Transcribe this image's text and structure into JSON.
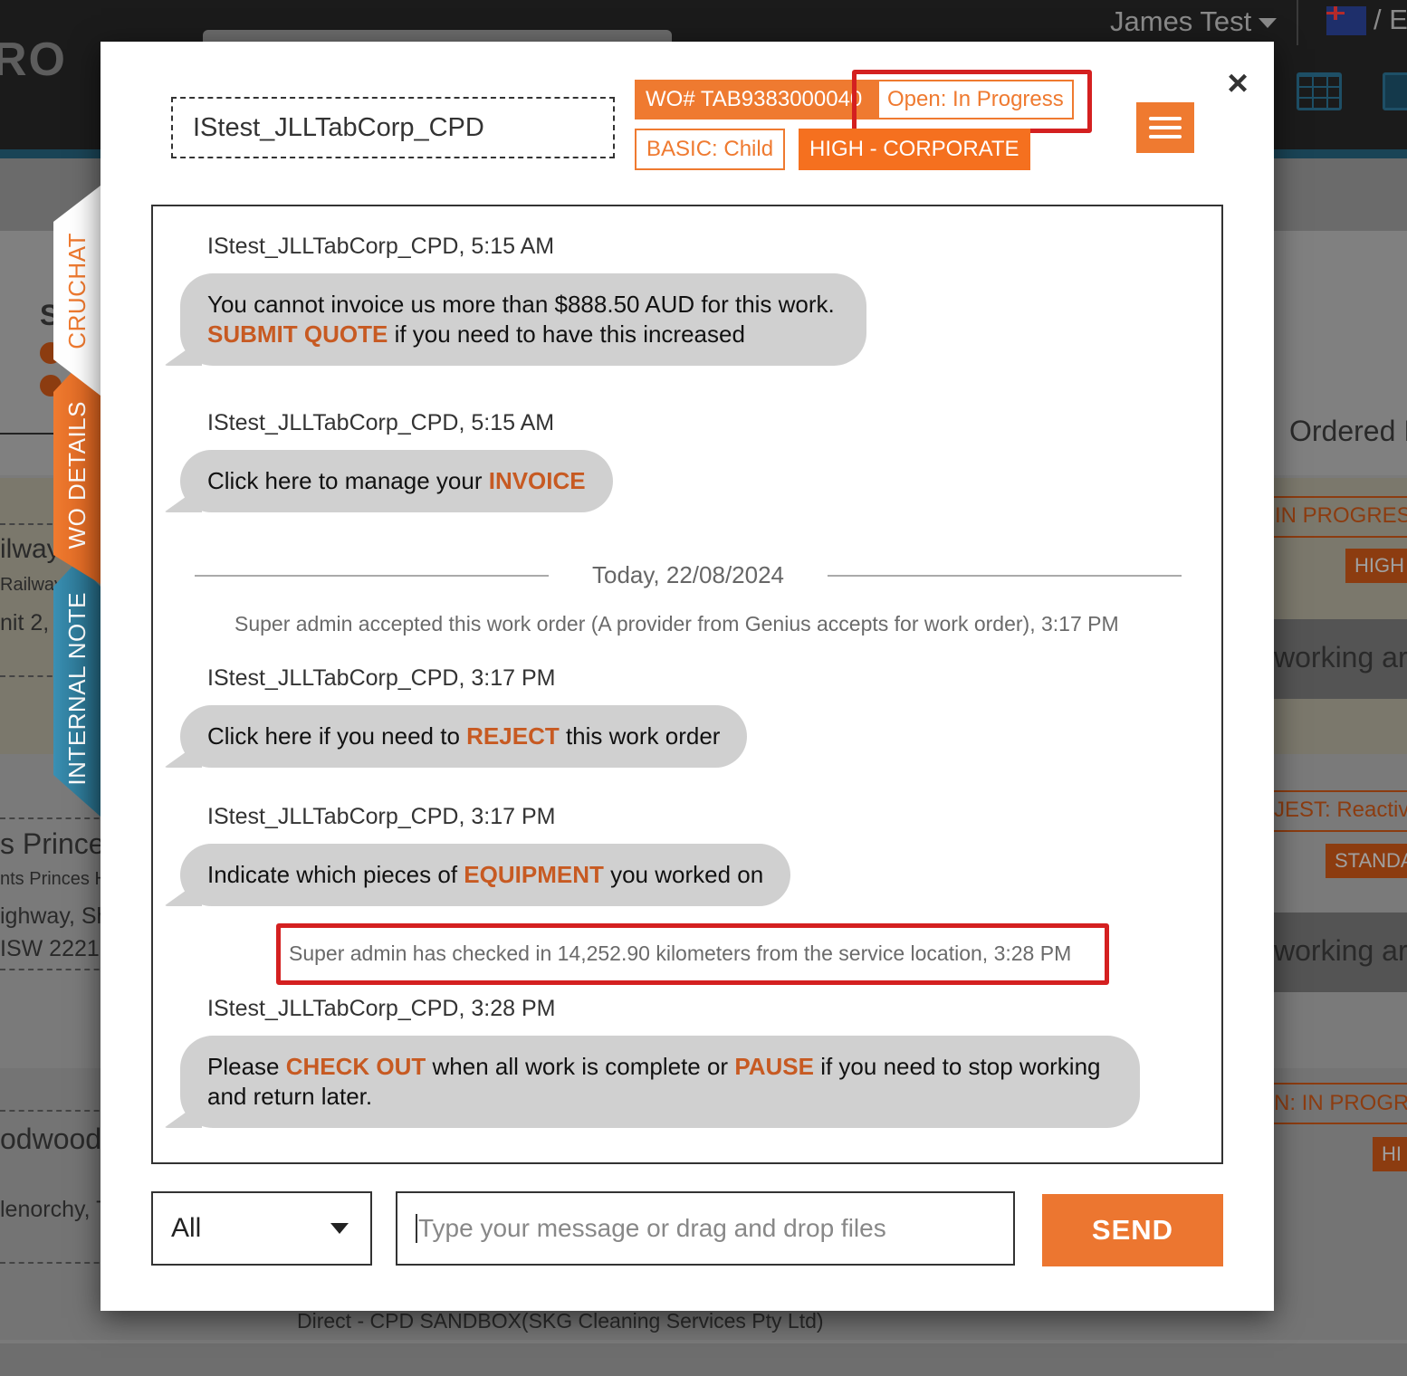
{
  "background": {
    "logo_text": "RO",
    "user_name": "James Test",
    "lang_text": "/ E",
    "left_texts": [
      "S",
      "ilway",
      "Railway",
      "nit 2,",
      "s Prince",
      "nts Princes H",
      "ighway, Sh",
      "ISW 2221",
      "odwood",
      "lenorchy, T"
    ],
    "right_texts": {
      "ordered": "Ordered I",
      "status_1": "IN PROGRESS",
      "priority_1": "HIGH",
      "working_1": "working ar",
      "type_2": "JEST: Reactive",
      "priority_2": "STANDA",
      "working_2": "working ar",
      "status_3": "N: IN PROGRE",
      "priority_3": "HI"
    },
    "footer_text": "Direct - CPD SANDBOX(SKG Cleaning Services Pty Ltd)"
  },
  "modal": {
    "title": "IStest_JLLTabCorp_CPD",
    "wo_number": "WO# TAB9383000040",
    "status": "Open: In Progress",
    "type": "BASIC: Child",
    "priority": "HIGH - CORPORATE",
    "close_icon": "×",
    "menu_icon": "hamburger-menu-icon",
    "side_tabs": [
      {
        "label": "CRUCHAT",
        "active": true
      },
      {
        "label": "WO DETAILS",
        "active": false
      },
      {
        "label": "INTERNAL NOTE",
        "active": false
      }
    ]
  },
  "chat": {
    "messages": [
      {
        "meta": "IStest_JLLTabCorp_CPD, 5:15 AM",
        "line1": "You cannot invoice us more than $888.50 AUD for this work.",
        "keyword": "SUBMIT QUOTE",
        "after": " if you need to have this increased"
      },
      {
        "meta": "IStest_JLLTabCorp_CPD, 5:15 AM",
        "before": "Click here to manage your ",
        "keyword": "INVOICE"
      },
      {
        "meta": "IStest_JLLTabCorp_CPD, 3:17 PM",
        "before": "Click here if you need to ",
        "keyword": "REJECT",
        "after": " this work order"
      },
      {
        "meta": "IStest_JLLTabCorp_CPD, 3:17 PM",
        "before": "Indicate which pieces of ",
        "keyword": "EQUIPMENT",
        "after": " you worked on"
      },
      {
        "meta": "IStest_JLLTabCorp_CPD, 3:28 PM",
        "before": "Please ",
        "keyword": "CHECK OUT",
        "middle": " when all work is complete or ",
        "keyword2": "PAUSE",
        "after": " if you need to stop working and return later."
      }
    ],
    "date_separator": "Today, 22/08/2024",
    "system_messages": [
      "Super admin accepted this work order (A provider from Genius accepts for work order), 3:17 PM",
      "Super admin has checked in 14,252.90 kilometers from the service location, 3:28 PM"
    ]
  },
  "composer": {
    "audience_value": "All",
    "placeholder": "Type your message or drag and drop files",
    "send_label": "SEND"
  },
  "colors": {
    "accent": "#ef7a30",
    "keyword": "#c75a22",
    "highlight": "#d42020",
    "internal_note": "#2f7fa0"
  }
}
